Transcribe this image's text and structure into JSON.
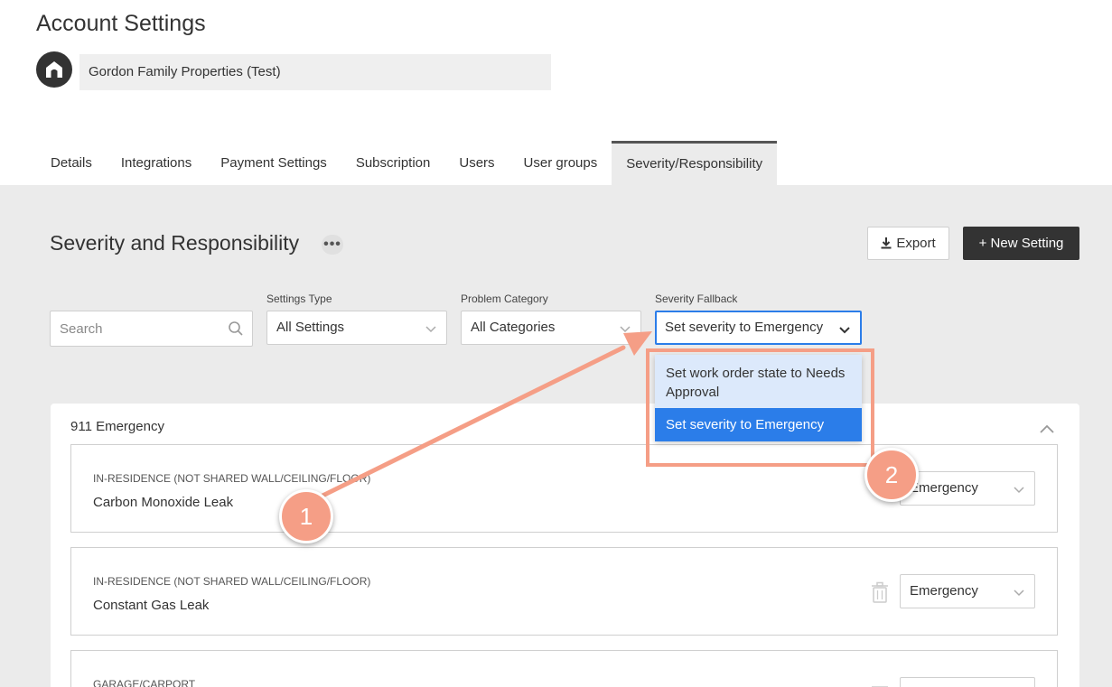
{
  "header": {
    "title": "Account Settings",
    "avatar_icon": "home-icon",
    "account_name": "Gordon Family Properties (Test)"
  },
  "tabs": [
    {
      "label": "Details",
      "active": false
    },
    {
      "label": "Integrations",
      "active": false
    },
    {
      "label": "Payment Settings",
      "active": false
    },
    {
      "label": "Subscription",
      "active": false
    },
    {
      "label": "Users",
      "active": false
    },
    {
      "label": "User groups",
      "active": false
    },
    {
      "label": "Severity/Responsibility",
      "active": true
    }
  ],
  "section": {
    "title": "Severity and Responsibility",
    "more_glyph": "•••",
    "export_label": "Export",
    "new_setting_label": "+ New Setting"
  },
  "filters": {
    "search_placeholder": "Search",
    "settings_type_label": "Settings Type",
    "settings_type_value": "All Settings",
    "problem_category_label": "Problem Category",
    "problem_category_value": "All Categories",
    "severity_fallback_label": "Severity Fallback",
    "severity_fallback_value": "Set severity to Emergency",
    "severity_fallback_options": [
      "Set work order state to Needs Approval",
      "Set severity to Emergency"
    ]
  },
  "group": {
    "title": "911 Emergency",
    "rows": [
      {
        "category": "In-Residence (Not Shared Wall/Ceiling/Floor)",
        "problem": "Carbon Monoxide Leak",
        "severity": "Emergency"
      },
      {
        "category": "In-Residence (Not Shared Wall/Ceiling/Floor)",
        "problem": "Constant Gas Leak",
        "severity": "Emergency"
      },
      {
        "category": "Garage/Carport",
        "problem": "",
        "severity": ""
      }
    ]
  },
  "annotations": {
    "badge1": "1",
    "badge2": "2",
    "accent_color": "#f59e86"
  }
}
